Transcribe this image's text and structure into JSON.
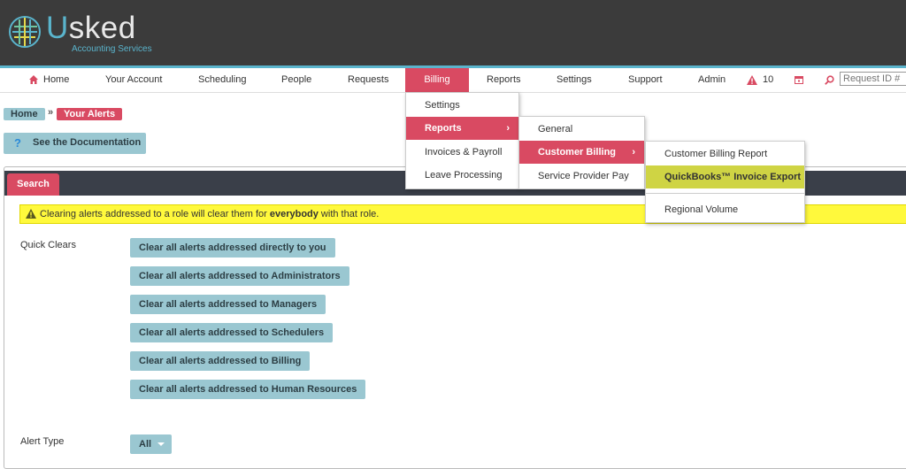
{
  "brand": {
    "name_u": "U",
    "name_rest": "sked",
    "subtitle": "Accounting Services"
  },
  "nav": {
    "home": "Home",
    "your_account": "Your Account",
    "scheduling": "Scheduling",
    "people": "People",
    "requests": "Requests",
    "billing": "Billing",
    "reports": "Reports",
    "settings": "Settings",
    "support": "Support",
    "admin": "Admin",
    "alert_count": "10",
    "request_placeholder": "Request ID #"
  },
  "breadcrumb": {
    "home": "Home",
    "sep": "»",
    "current": "Your Alerts"
  },
  "documentation": {
    "icon": "question-icon",
    "label": "See the Documentation"
  },
  "panel": {
    "tab": "Search"
  },
  "alert": {
    "before": "Clearing alerts addressed to a role will clear them for ",
    "bold": "everybody",
    "after": " with that role."
  },
  "quick_clears": {
    "label": "Quick Clears",
    "buttons": [
      "Clear all alerts addressed directly to you",
      "Clear all alerts addressed to Administrators",
      "Clear all alerts addressed to Managers",
      "Clear all alerts addressed to Schedulers",
      "Clear all alerts addressed to Billing",
      "Clear all alerts addressed to Human Resources"
    ]
  },
  "alert_type": {
    "label": "Alert Type",
    "value": "All"
  },
  "billing_menu": [
    "Settings",
    "Reports",
    "Invoices & Payroll",
    "Leave Processing"
  ],
  "reports_menu": [
    "General",
    "Customer Billing",
    "Service Provider Pay"
  ],
  "customer_billing_menu": [
    "Customer Billing Report",
    "QuickBooks™ Invoice Export",
    "Regional Volume"
  ],
  "colors": {
    "accent": "#d94a62",
    "button": "#9ac7d1",
    "header": "#3b3b3b",
    "brand_blue": "#5ab4cc",
    "highlight": "#cfd444",
    "alert": "#fff93c"
  }
}
